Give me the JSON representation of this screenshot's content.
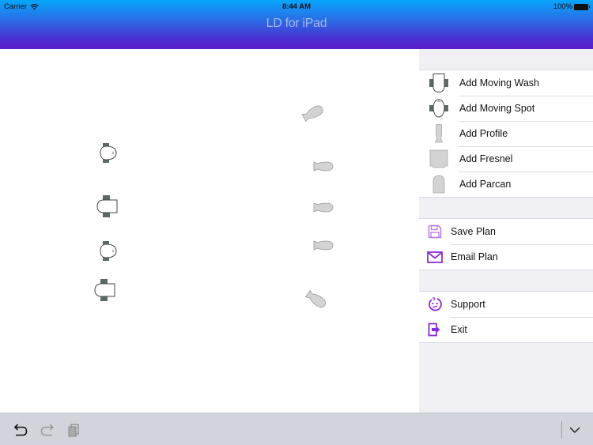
{
  "status_bar": {
    "carrier": "Carrier",
    "time": "8:44 AM",
    "battery": "100%"
  },
  "header": {
    "title": "LD for iPad"
  },
  "canvas": {
    "fixtures": [
      {
        "type": "moving-spot",
        "label": "Moving Spot fixture"
      },
      {
        "type": "moving-wash",
        "label": "Moving Wash fixture"
      },
      {
        "type": "moving-spot",
        "label": "Moving Spot fixture"
      },
      {
        "type": "moving-wash",
        "label": "Moving Wash fixture"
      },
      {
        "type": "profile",
        "label": "Profile fixture"
      },
      {
        "type": "profile",
        "label": "Profile fixture"
      },
      {
        "type": "profile",
        "label": "Profile fixture"
      },
      {
        "type": "profile",
        "label": "Profile fixture"
      },
      {
        "type": "profile",
        "label": "Profile fixture"
      }
    ]
  },
  "sidebar": {
    "fixture_items": [
      {
        "label": "Add Moving Wash",
        "icon": "moving-wash-icon"
      },
      {
        "label": "Add Moving Spot",
        "icon": "moving-spot-icon"
      },
      {
        "label": "Add Profile",
        "icon": "profile-icon"
      },
      {
        "label": "Add Fresnel",
        "icon": "fresnel-icon"
      },
      {
        "label": "Add Parcan",
        "icon": "parcan-icon"
      }
    ],
    "plan_items": [
      {
        "label": "Save Plan",
        "icon": "floppy-disk-icon"
      },
      {
        "label": "Email Plan",
        "icon": "envelope-icon"
      }
    ],
    "app_items": [
      {
        "label": "Support",
        "icon": "confused-face-icon"
      },
      {
        "label": "Exit",
        "icon": "exit-icon"
      }
    ]
  },
  "toolbar": {
    "undo": "undo-icon",
    "redo": "redo-icon",
    "paste": "paste-icon",
    "dismiss": "keyboard-dismiss-icon"
  },
  "colors": {
    "accent": "#8a2be2",
    "header_top": "#06a6fb",
    "header_bottom": "#5a1ec8",
    "sidebar_bg": "#efeff4",
    "toolbar_bg": "#d1d4da"
  }
}
